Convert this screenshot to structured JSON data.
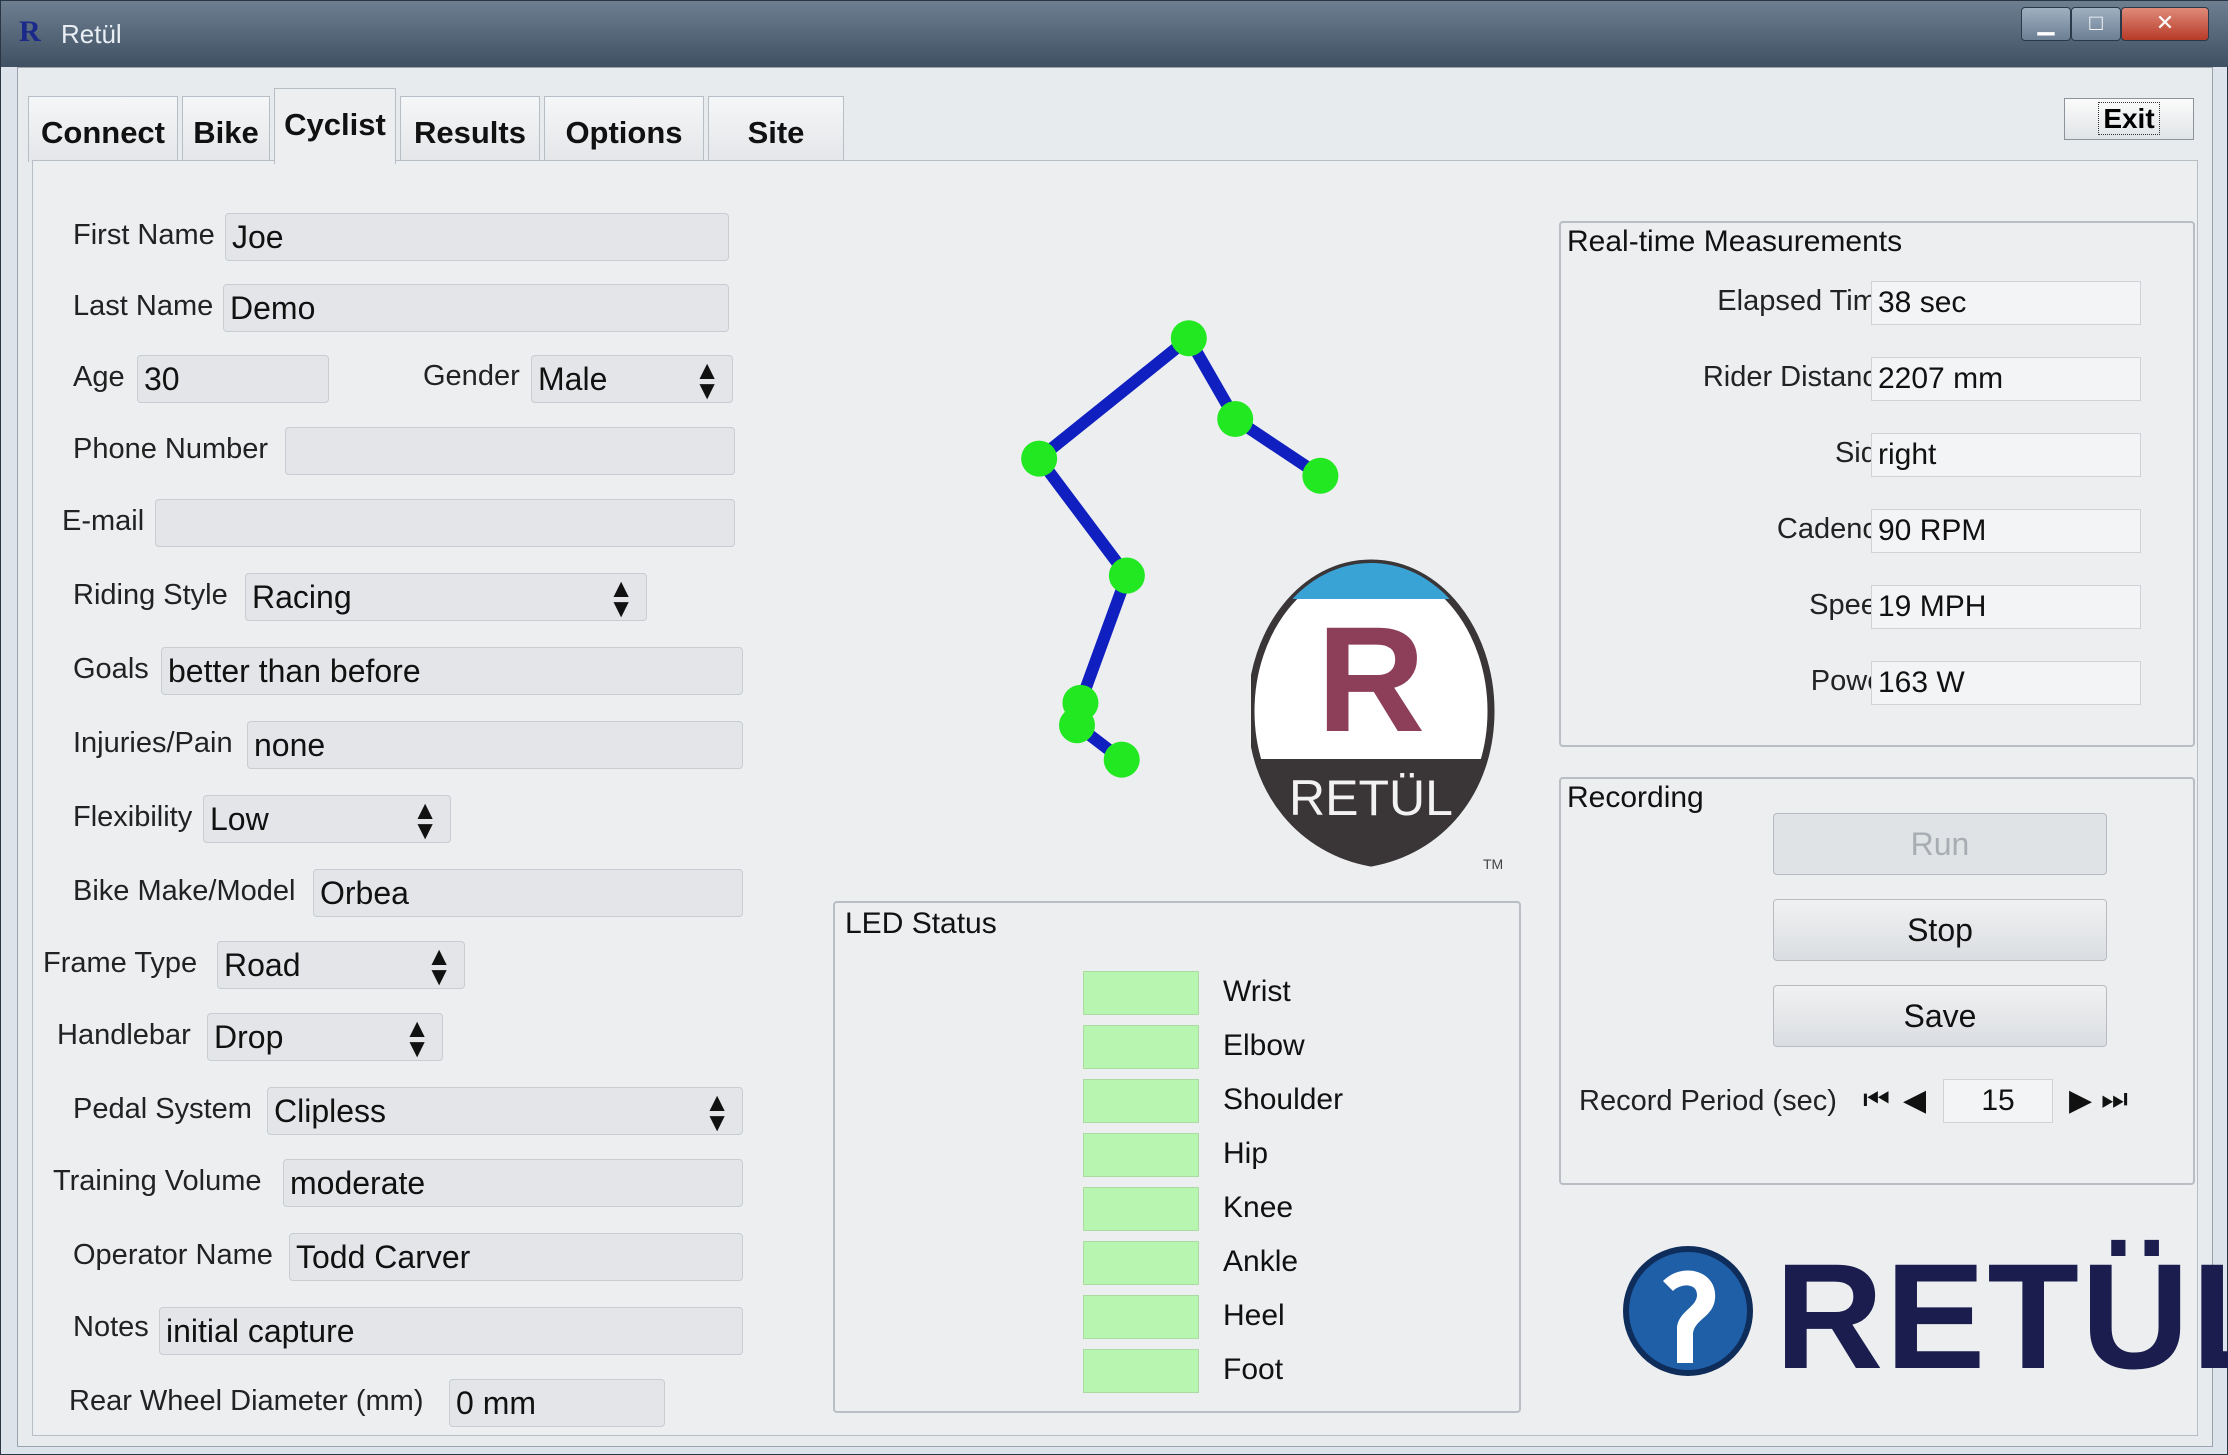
{
  "window": {
    "title": "Retül",
    "app_icon": "R",
    "min": "▁",
    "max": "□",
    "close": "✕"
  },
  "tabs": [
    "Connect",
    "Bike",
    "Cyclist",
    "Results",
    "Options",
    "Site"
  ],
  "active_tab": "Cyclist",
  "exit_label": "Exit",
  "form": {
    "first_name": {
      "label": "First Name",
      "value": "Joe"
    },
    "last_name": {
      "label": "Last Name",
      "value": "Demo"
    },
    "age": {
      "label": "Age",
      "value": "30"
    },
    "gender": {
      "label": "Gender",
      "value": "Male"
    },
    "phone": {
      "label": "Phone Number",
      "value": ""
    },
    "email": {
      "label": "E-mail",
      "value": ""
    },
    "riding_style": {
      "label": "Riding Style",
      "value": "Racing"
    },
    "goals": {
      "label": "Goals",
      "value": "better than before"
    },
    "injuries": {
      "label": "Injuries/Pain",
      "value": "none"
    },
    "flexibility": {
      "label": "Flexibility",
      "value": "Low"
    },
    "bike_make": {
      "label": "Bike Make/Model",
      "value": "Orbea"
    },
    "frame_type": {
      "label": "Frame Type",
      "value": "Road"
    },
    "handlebar": {
      "label": "Handlebar",
      "value": "Drop"
    },
    "pedal_system": {
      "label": "Pedal System",
      "value": "Clipless"
    },
    "training_volume": {
      "label": "Training Volume",
      "value": "moderate"
    },
    "operator_name": {
      "label": "Operator Name",
      "value": "Todd Carver"
    },
    "notes": {
      "label": "Notes",
      "value": "initial capture"
    },
    "rear_wheel": {
      "label": "Rear Wheel Diameter (mm)",
      "value": "0 mm"
    }
  },
  "skeleton": {
    "line_color": "#1020c0",
    "point_color": "#22e822"
  },
  "badge": {
    "letter": "R",
    "text": "RETÜL",
    "tm": "TM"
  },
  "led_status": {
    "title": "LED Status",
    "items": [
      "Wrist",
      "Elbow",
      "Shoulder",
      "Hip",
      "Knee",
      "Ankle",
      "Heel",
      "Foot"
    ],
    "led_color": "#b8f5b0"
  },
  "realtime": {
    "title": "Real-time Measurements",
    "rows": [
      {
        "label": "Elapsed Time",
        "value": "38 sec"
      },
      {
        "label": "Rider Distance",
        "value": "2207 mm"
      },
      {
        "label": "Side",
        "value": "right"
      },
      {
        "label": "Cadence",
        "value": "90 RPM"
      },
      {
        "label": "Speed",
        "value": "19 MPH"
      },
      {
        "label": "Power",
        "value": "163  W"
      }
    ]
  },
  "recording": {
    "title": "Recording",
    "run": "Run",
    "stop": "Stop",
    "save": "Save",
    "period_label": "Record Period (sec)",
    "period_value": "15"
  },
  "logo_text": "RETÜL"
}
